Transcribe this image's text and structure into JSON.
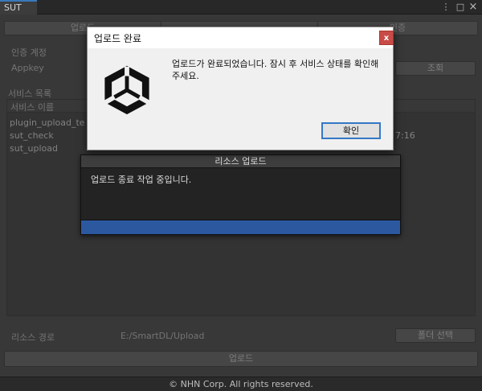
{
  "window": {
    "tab_title": "SUT",
    "menu_icon": "⋮",
    "maximize_icon": "□",
    "close_icon": "×"
  },
  "top_tabs": [
    "업로드",
    "",
    "인증"
  ],
  "auth": {
    "section_label": "인증 계정",
    "appkey_label": "Appkey",
    "lookup_button": "조회"
  },
  "services": {
    "section_label": "서비스 목록",
    "column_name": "서비스 이름",
    "items": [
      "plugin_upload_te",
      "sut_check",
      "sut_upload"
    ],
    "partial_time": "7:16"
  },
  "resource": {
    "path_label": "리소스 경로",
    "path_value": "E:/SmartDL/Upload",
    "folder_button": "폴더 선택"
  },
  "upload_button": "업로드",
  "footer": "© NHN Corp. All rights reserved.",
  "progress": {
    "title": "리소스 업로드",
    "message": "업로드 종료 작업 중입니다.",
    "fraction": 1.0,
    "fill_color": "#2c58a0"
  },
  "modal": {
    "title": "업로드 완료",
    "close_label": "x",
    "message": "업로드가 완료되었습니다. 잠시 후 서비스 상태를 확인해 주세요.",
    "ok_label": "확인",
    "logo_icon": "unity-logo-icon"
  }
}
